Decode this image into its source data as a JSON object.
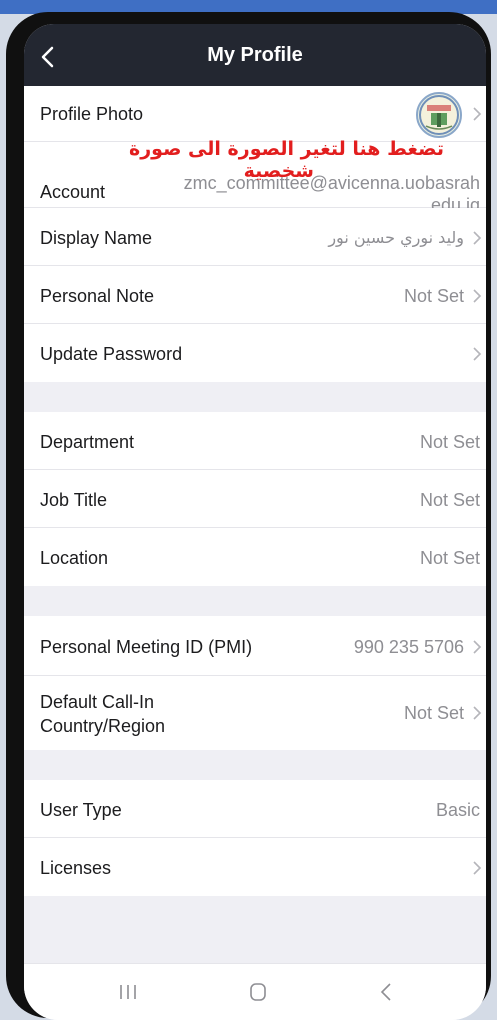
{
  "header": {
    "title": "My Profile"
  },
  "annotation": {
    "line1": "تضغط هنا لتغير الصورة الى صورة",
    "line2": "شخصية"
  },
  "rows": {
    "profile_photo": {
      "label": "Profile Photo"
    },
    "account": {
      "label": "Account",
      "value_line1": "zmc_committee@avicenna.uobasrah",
      "value_line2": ".edu.iq"
    },
    "display_name": {
      "label": "Display Name",
      "value": "وليد نوري حسين نور"
    },
    "personal_note": {
      "label": "Personal Note",
      "value": "Not Set"
    },
    "update_password": {
      "label": "Update Password"
    },
    "department": {
      "label": "Department",
      "value": "Not Set"
    },
    "job_title": {
      "label": "Job Title",
      "value": "Not Set"
    },
    "location": {
      "label": "Location",
      "value": "Not Set"
    },
    "pmi": {
      "label": "Personal Meeting ID (PMI)",
      "value": "990 235 5706"
    },
    "call_in": {
      "label_line1": "Default Call-In",
      "label_line2": "Country/Region",
      "value": "Not Set"
    },
    "user_type": {
      "label": "User Type",
      "value": "Basic"
    },
    "licenses": {
      "label": "Licenses"
    }
  },
  "icons": {
    "back": "chevron-left-icon",
    "row_arrow": "chevron-right-icon",
    "nav_recents": "recent-apps-icon",
    "nav_home": "home-icon",
    "nav_back": "back-icon"
  },
  "colors": {
    "header_bg": "#232731",
    "annotation_red": "#e21e1e",
    "value_gray": "#8e8e93",
    "frame_blue": "#3f6fc4"
  }
}
